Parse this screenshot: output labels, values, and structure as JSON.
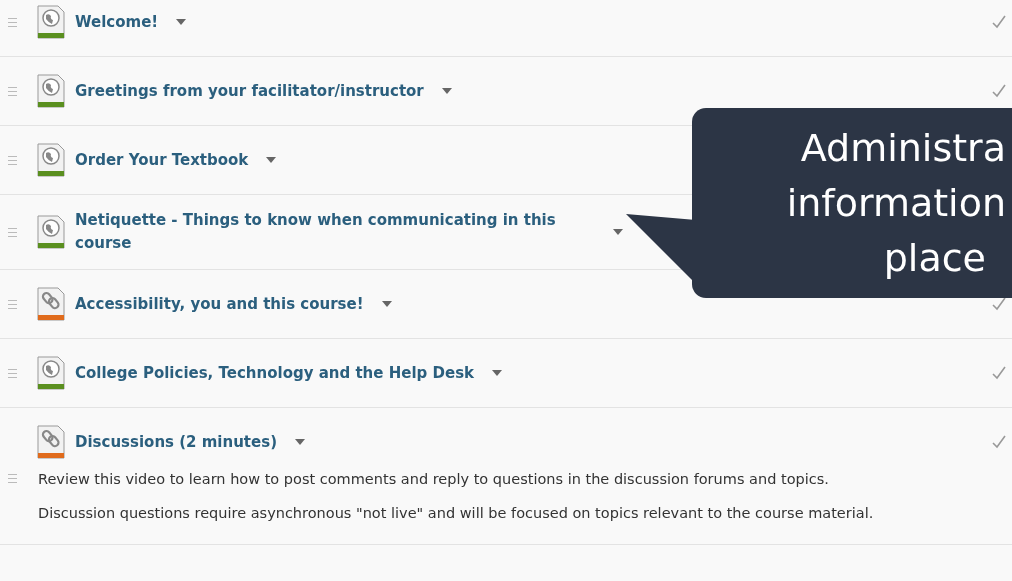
{
  "items": [
    {
      "kind": "web",
      "title": "Welcome!",
      "completed": true
    },
    {
      "kind": "web",
      "title": "Greetings from your facilitator/instructor",
      "completed": true
    },
    {
      "kind": "web",
      "title": "Order Your Textbook"
    },
    {
      "kind": "web",
      "title": "Netiquette - Things to know when communicating in this course"
    },
    {
      "kind": "link",
      "title": "Accessibility, you and this course!",
      "completed": true
    },
    {
      "kind": "web",
      "title": "College Policies, Technology and the Help Desk",
      "completed": true
    },
    {
      "kind": "link",
      "title": "Discussions (2 minutes)",
      "completed": true,
      "description": [
        "Review this video to learn how to post comments and reply to questions in the discussion forums and topics.",
        "Discussion questions require asynchronous \"not live\"  and will be focused on topics relevant to the course material."
      ]
    }
  ],
  "callout": {
    "lines": [
      "Administra",
      "information",
      "place"
    ]
  }
}
